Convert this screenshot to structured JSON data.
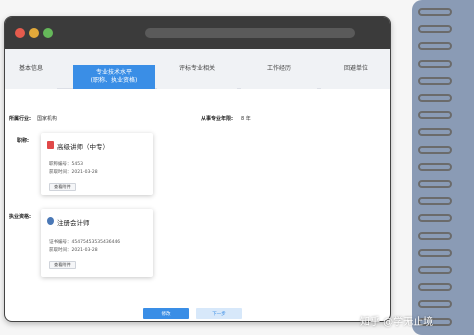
{
  "tabs": [
    {
      "label": "基本信息",
      "active": false
    },
    {
      "label": "专业技术水平\n(职称、执业资格)",
      "active": true
    },
    {
      "label": "评标专业相关",
      "active": false
    },
    {
      "label": "工作经历",
      "active": false
    },
    {
      "label": "回避单位",
      "active": false
    }
  ],
  "profile": {
    "industry_label": "所属行业:",
    "industry_value": "国家机构",
    "years_label": "从事专业年限:",
    "years_value": "8 年",
    "title_label": "职称:",
    "qualification_label": "执业资格:"
  },
  "title_card": {
    "title": "高级讲师（中专）",
    "meta": [
      "职称编号：5453",
      "获取时间：2021-03-28"
    ],
    "attach_label": "查看附件"
  },
  "qualification_card": {
    "title": "注册会计师",
    "meta": [
      "证书编号：45475453535436446",
      "获取时间：2021-03-28"
    ],
    "attach_label": "查看附件"
  },
  "buttons": {
    "primary": "修改",
    "secondary": "下一步"
  },
  "watermark": "知乎 @学无止境",
  "colors": {
    "accent": "#3a8ee6",
    "titlebar": "#3b3b3b",
    "notebook": "#8a9bb5"
  }
}
